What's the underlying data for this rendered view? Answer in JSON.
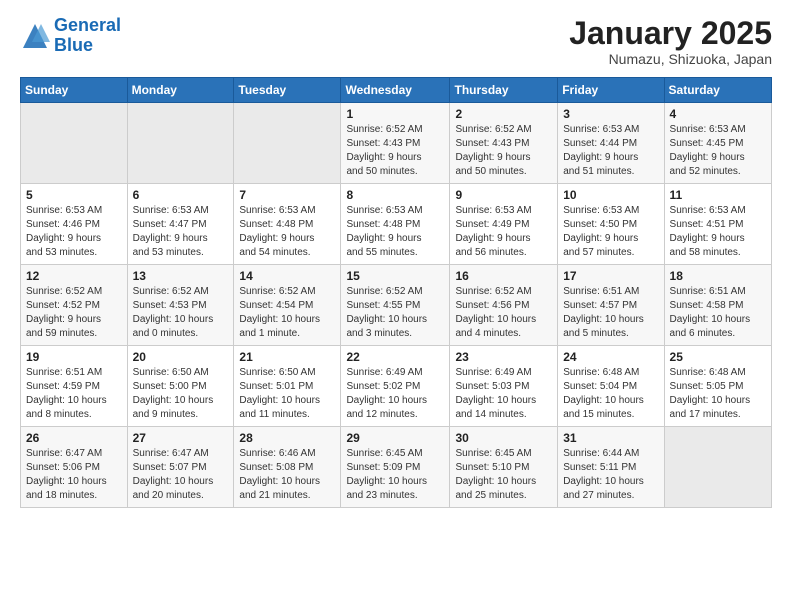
{
  "header": {
    "logo_general": "General",
    "logo_blue": "Blue",
    "month_title": "January 2025",
    "location": "Numazu, Shizuoka, Japan"
  },
  "weekdays": [
    "Sunday",
    "Monday",
    "Tuesday",
    "Wednesday",
    "Thursday",
    "Friday",
    "Saturday"
  ],
  "weeks": [
    [
      {
        "day": "",
        "info": ""
      },
      {
        "day": "",
        "info": ""
      },
      {
        "day": "",
        "info": ""
      },
      {
        "day": "1",
        "info": "Sunrise: 6:52 AM\nSunset: 4:43 PM\nDaylight: 9 hours\nand 50 minutes."
      },
      {
        "day": "2",
        "info": "Sunrise: 6:52 AM\nSunset: 4:43 PM\nDaylight: 9 hours\nand 50 minutes."
      },
      {
        "day": "3",
        "info": "Sunrise: 6:53 AM\nSunset: 4:44 PM\nDaylight: 9 hours\nand 51 minutes."
      },
      {
        "day": "4",
        "info": "Sunrise: 6:53 AM\nSunset: 4:45 PM\nDaylight: 9 hours\nand 52 minutes."
      }
    ],
    [
      {
        "day": "5",
        "info": "Sunrise: 6:53 AM\nSunset: 4:46 PM\nDaylight: 9 hours\nand 53 minutes."
      },
      {
        "day": "6",
        "info": "Sunrise: 6:53 AM\nSunset: 4:47 PM\nDaylight: 9 hours\nand 53 minutes."
      },
      {
        "day": "7",
        "info": "Sunrise: 6:53 AM\nSunset: 4:48 PM\nDaylight: 9 hours\nand 54 minutes."
      },
      {
        "day": "8",
        "info": "Sunrise: 6:53 AM\nSunset: 4:48 PM\nDaylight: 9 hours\nand 55 minutes."
      },
      {
        "day": "9",
        "info": "Sunrise: 6:53 AM\nSunset: 4:49 PM\nDaylight: 9 hours\nand 56 minutes."
      },
      {
        "day": "10",
        "info": "Sunrise: 6:53 AM\nSunset: 4:50 PM\nDaylight: 9 hours\nand 57 minutes."
      },
      {
        "day": "11",
        "info": "Sunrise: 6:53 AM\nSunset: 4:51 PM\nDaylight: 9 hours\nand 58 minutes."
      }
    ],
    [
      {
        "day": "12",
        "info": "Sunrise: 6:52 AM\nSunset: 4:52 PM\nDaylight: 9 hours\nand 59 minutes."
      },
      {
        "day": "13",
        "info": "Sunrise: 6:52 AM\nSunset: 4:53 PM\nDaylight: 10 hours\nand 0 minutes."
      },
      {
        "day": "14",
        "info": "Sunrise: 6:52 AM\nSunset: 4:54 PM\nDaylight: 10 hours\nand 1 minute."
      },
      {
        "day": "15",
        "info": "Sunrise: 6:52 AM\nSunset: 4:55 PM\nDaylight: 10 hours\nand 3 minutes."
      },
      {
        "day": "16",
        "info": "Sunrise: 6:52 AM\nSunset: 4:56 PM\nDaylight: 10 hours\nand 4 minutes."
      },
      {
        "day": "17",
        "info": "Sunrise: 6:51 AM\nSunset: 4:57 PM\nDaylight: 10 hours\nand 5 minutes."
      },
      {
        "day": "18",
        "info": "Sunrise: 6:51 AM\nSunset: 4:58 PM\nDaylight: 10 hours\nand 6 minutes."
      }
    ],
    [
      {
        "day": "19",
        "info": "Sunrise: 6:51 AM\nSunset: 4:59 PM\nDaylight: 10 hours\nand 8 minutes."
      },
      {
        "day": "20",
        "info": "Sunrise: 6:50 AM\nSunset: 5:00 PM\nDaylight: 10 hours\nand 9 minutes."
      },
      {
        "day": "21",
        "info": "Sunrise: 6:50 AM\nSunset: 5:01 PM\nDaylight: 10 hours\nand 11 minutes."
      },
      {
        "day": "22",
        "info": "Sunrise: 6:49 AM\nSunset: 5:02 PM\nDaylight: 10 hours\nand 12 minutes."
      },
      {
        "day": "23",
        "info": "Sunrise: 6:49 AM\nSunset: 5:03 PM\nDaylight: 10 hours\nand 14 minutes."
      },
      {
        "day": "24",
        "info": "Sunrise: 6:48 AM\nSunset: 5:04 PM\nDaylight: 10 hours\nand 15 minutes."
      },
      {
        "day": "25",
        "info": "Sunrise: 6:48 AM\nSunset: 5:05 PM\nDaylight: 10 hours\nand 17 minutes."
      }
    ],
    [
      {
        "day": "26",
        "info": "Sunrise: 6:47 AM\nSunset: 5:06 PM\nDaylight: 10 hours\nand 18 minutes."
      },
      {
        "day": "27",
        "info": "Sunrise: 6:47 AM\nSunset: 5:07 PM\nDaylight: 10 hours\nand 20 minutes."
      },
      {
        "day": "28",
        "info": "Sunrise: 6:46 AM\nSunset: 5:08 PM\nDaylight: 10 hours\nand 21 minutes."
      },
      {
        "day": "29",
        "info": "Sunrise: 6:45 AM\nSunset: 5:09 PM\nDaylight: 10 hours\nand 23 minutes."
      },
      {
        "day": "30",
        "info": "Sunrise: 6:45 AM\nSunset: 5:10 PM\nDaylight: 10 hours\nand 25 minutes."
      },
      {
        "day": "31",
        "info": "Sunrise: 6:44 AM\nSunset: 5:11 PM\nDaylight: 10 hours\nand 27 minutes."
      },
      {
        "day": "",
        "info": ""
      }
    ]
  ]
}
